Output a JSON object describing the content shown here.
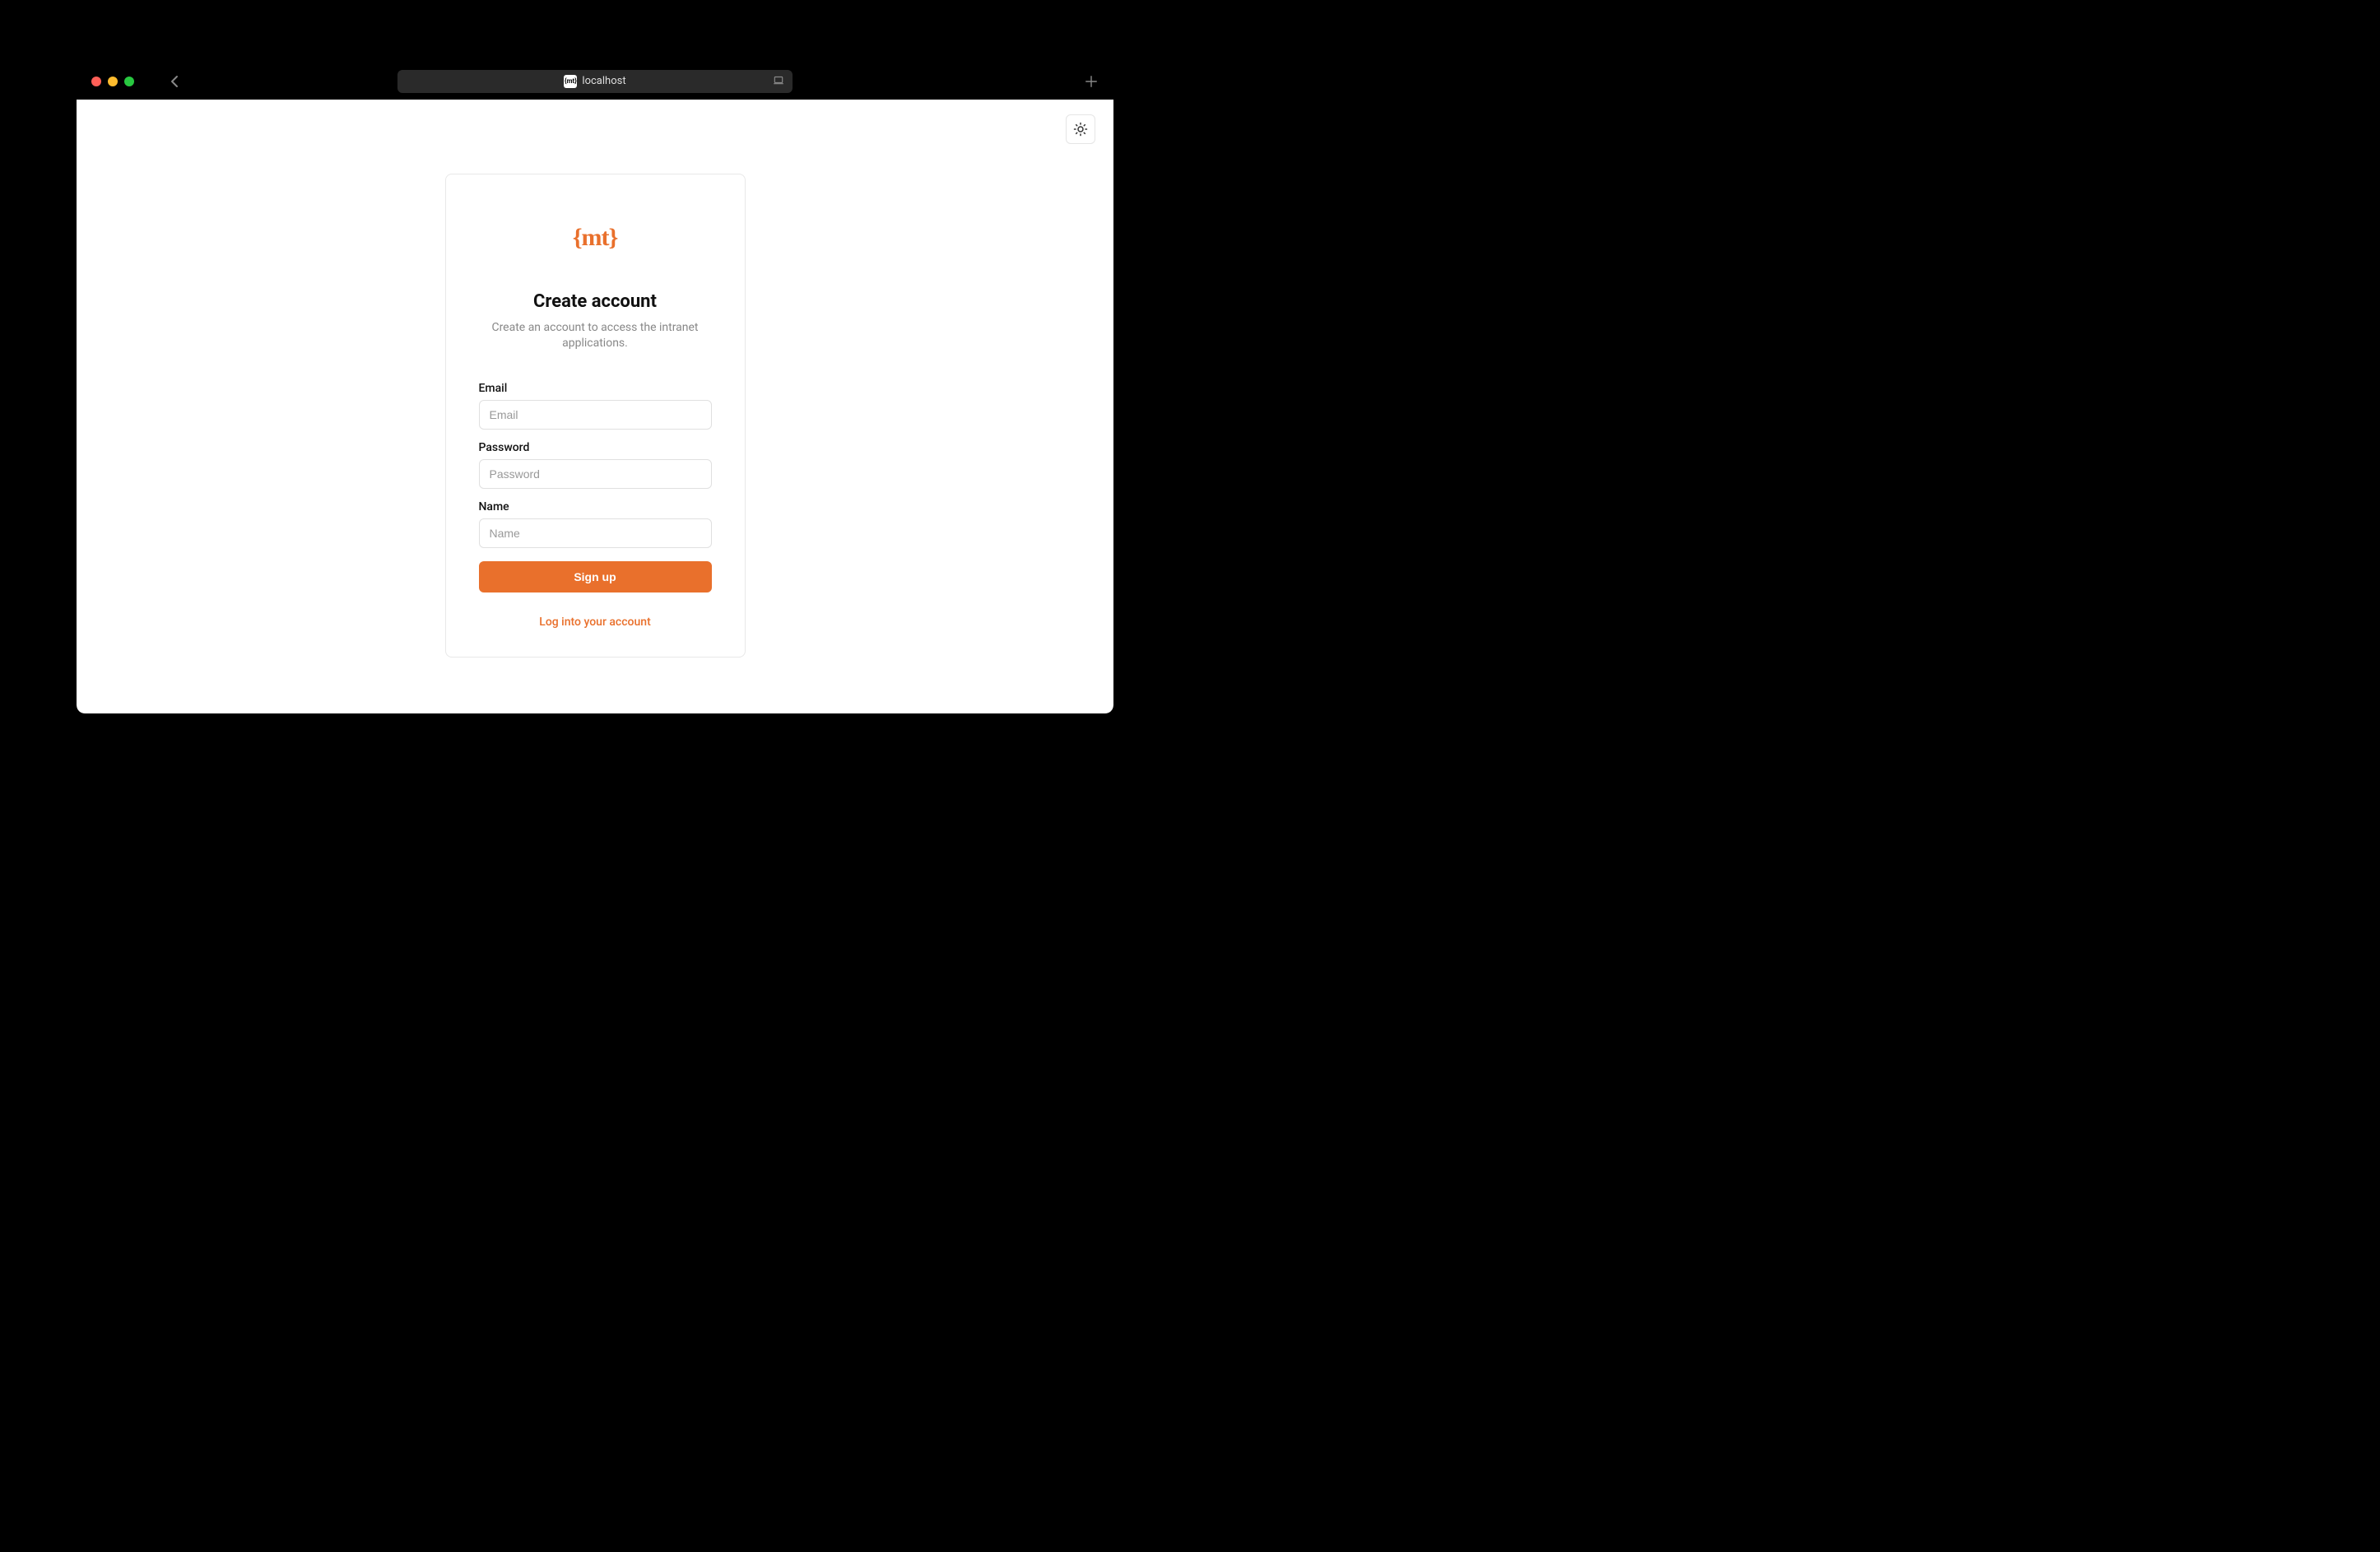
{
  "browser": {
    "address": "localhost",
    "favicon_text": "{mt}"
  },
  "page": {
    "logo": "{mt}",
    "title": "Create account",
    "subtitle": "Create an account to access the intranet applications.",
    "fields": {
      "email": {
        "label": "Email",
        "placeholder": "Email"
      },
      "password": {
        "label": "Password",
        "placeholder": "Password"
      },
      "name": {
        "label": "Name",
        "placeholder": "Name"
      }
    },
    "submit_label": "Sign up",
    "login_link_label": "Log into your account"
  }
}
